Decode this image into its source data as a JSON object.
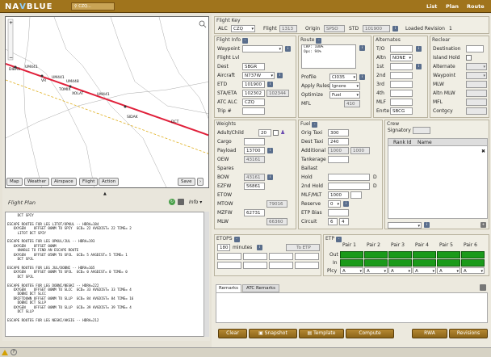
{
  "header": {
    "logo_a": "NA",
    "logo_b": "V",
    "logo_c": "BLUE",
    "search_placeholder": "CZQ...",
    "nav": [
      "List",
      "Plan",
      "Route"
    ]
  },
  "map": {
    "waypoints": [
      "DIBAS",
      "UM441",
      "VR",
      "UM441",
      "UM448",
      "TOMIX",
      "XOLAT",
      "UM441",
      "SIDAK",
      "DCT"
    ],
    "toolbar": [
      "Map",
      "Weather",
      "Airspace",
      "Flight",
      "Action"
    ],
    "save_label": "Save"
  },
  "flight_plan": {
    "title": "Flight Plan",
    "info_label": "Info",
    "text": "     DCT SPIY\n\nESCAPE ROUTES FOR LEG LITOT/OPKUL -- HDRA=184\n   OXYGEN    OFFSET 00NM TO SPIY  GCD= 22 AVGDIST= 22 TIME= 2\n     LITOT DCT SPIY\n\nESCAPE ROUTES FOR LEG OPKUL/JUL -- HDRA=193\n   OXYGEN    OFFSET 00NM\n     UNABLE TO FIND AN ESCAPE ROUTE\n   OXYGEN    OFFSET 05NM TO SPJL  GCD= 5 AVGDIST= 5 TIME= 1\n     DCT SPJL\n\nESCAPE ROUTES FOR LEG JUL/DOBNI -- HDRA=165\n   OXYGEN    OFFSET 00NM TO SPJL  GCD= 0 AVGDIST= 0 TIME= 0\n     DCT SPJL\n\nESCAPE ROUTES FOR LEG DOBNI/NESKI -- HDRA=222\n   OXYGEN    OFFSET 00NM TO SLCC  GCD= 33 AVGDIST= 33 TIME= 4\n     DOBNI DCT SLCC\n   DRIFTDOWN OFFSET 00NM TO SLLP  GCD= 84 AVGDIST= 84 TIME= 16\n     DOBNI DCT SLLP\n   OXYGEN    OFFSET 00NM TO SLLP  GCD= 39 AVGDIST= 39 TIME= 4\n     DCT SLLP\n\nESCAPE ROUTES FOR LEG NESKI/AKSIG -- HDRA=212"
  },
  "flight_key": {
    "title": "Flight Key",
    "alc_label": "ALC",
    "alc": "CZQ",
    "flight_label": "Flight",
    "flight": "1313",
    "origin_label": "Origin",
    "origin": "SPSO",
    "std_label": "STD",
    "std": "101900",
    "loaded_label": "Loaded Revision",
    "loaded": "1"
  },
  "flight_info": {
    "title": "Flight Info",
    "waypoint_label": "Waypoint",
    "flight_lvl_label": "Flight Lvl",
    "dest_label": "Dest",
    "dest": "SBGR",
    "aircraft_label": "Aircraft",
    "aircraft": "N737W",
    "etd_label": "ETD",
    "etd": "101900",
    "sta_label": "STA/ETA",
    "sta": "102302",
    "eta": "102344",
    "atc_label": "ATC ALC",
    "atc": "CZQ",
    "trip_label": "Trip #"
  },
  "route": {
    "title": "Route",
    "text1": "CRP: 100%",
    "text2": "Ops: 94%",
    "profile_label": "Profile",
    "profile": "CI035",
    "apply_label": "Apply Rules",
    "apply": "Ignore",
    "optimize_label": "Optimize",
    "optimize": "Fuel",
    "mfl_label": "MFL",
    "mfl": "410"
  },
  "alternates": {
    "title": "Alternates",
    "to_label": "T/O",
    "altn_label": "Altn",
    "altn": "NONE",
    "r1": "1st",
    "r2": "2nd",
    "r3": "3rd",
    "r4": "4th",
    "mlf_label": "MLF",
    "enrte_label": "Enrte",
    "enrte": "SBCG"
  },
  "reclear": {
    "title": "Reclear",
    "destination_label": "Destination",
    "island_label": "Island Hold",
    "alternate_label": "Alternate",
    "waypoint_label": "Waypoint",
    "mlw_label": "MLW",
    "altn_mlw_label": "Altn MLW",
    "mfl_label": "MFL",
    "contgcy_label": "Contgcy"
  },
  "weights": {
    "title": "Weights",
    "adult_label": "Adult/Child",
    "adult": "20",
    "cargo_label": "Cargo",
    "payload_label": "Payload",
    "payload": "13700",
    "oew_label": "OEW",
    "oew": "43161",
    "spares_label": "Spares",
    "bow_label": "BOW",
    "bow": "43161",
    "ezfw_label": "EZFW",
    "ezfw": "56861",
    "etow_label": "ETOW",
    "mtow_label": "MTOW",
    "mtow": "79016",
    "mzfw_label": "MZFW",
    "mzfw": "62731",
    "mlw_label": "MLW",
    "mlw": "66360"
  },
  "fuel": {
    "title": "Fuel",
    "orig_label": "Orig Taxi",
    "orig": "300",
    "dest_label": "Dest Taxi",
    "dest": "240",
    "add_label": "Additional",
    "add1": "1000",
    "add2": "1000",
    "tank_label": "Tankerage",
    "ballast_label": "Ballast",
    "hold_label": "Hold",
    "d": "D",
    "hold2_label": "2nd Hold",
    "mlf_label": "MLF/MLT",
    "mlf": "1000",
    "reserve_label": "Reserve",
    "reserve": "0",
    "etp_label": "ETP Bias",
    "circuit_label": "Circuit",
    "circuit1": "6",
    "circuit2": "4"
  },
  "crew": {
    "title": "Crew",
    "signatory_label": "Signatory",
    "rank_label": "Rank Id",
    "name_label": "Name"
  },
  "etops": {
    "title": "ETOPS",
    "minutes": "180",
    "minutes_label": "minutes",
    "to_etp": "To ETP"
  },
  "etp": {
    "title": "ETP",
    "pairs": [
      "Pair 1",
      "Pair 2",
      "Pair 3",
      "Pair 4",
      "Pair 5",
      "Pair 6"
    ],
    "out_label": "Out",
    "in_label": "In",
    "plcy_label": "Plcy",
    "plcy": "A"
  },
  "remarks": {
    "tabs": [
      "Remarks",
      "ATC Remarks"
    ]
  },
  "actions": {
    "buttons": [
      "Clear",
      "Snapshot",
      "Template",
      "Compute",
      "RWA",
      "Revisions"
    ]
  },
  "colors": {
    "brand": "#a0741c",
    "route": "#e0203a",
    "boundary": "#e0b020",
    "green": "#1a9a1a"
  }
}
